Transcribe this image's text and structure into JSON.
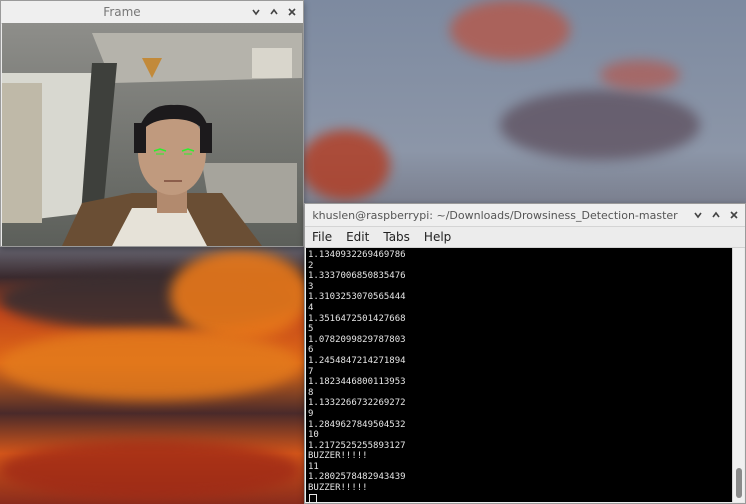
{
  "frame_window": {
    "title": "Frame",
    "controls": [
      "chevron-down-icon",
      "chevron-up-icon",
      "close-icon"
    ]
  },
  "terminal_window": {
    "title": "khuslen@raspberrypi: ~/Downloads/Drowsiness_Detection-master",
    "menu": [
      "File",
      "Edit",
      "Tabs",
      "Help"
    ],
    "lines": [
      "1.1340932269469786",
      "2",
      "1.3337006850835476",
      "3",
      "1.3103253070565444",
      "4",
      "1.3516472501427668",
      "5",
      "1.0782099829787803",
      "6",
      "1.2454847214271894",
      "7",
      "1.1823446800113953",
      "8",
      "1.1332266732269272",
      "9",
      "1.2849627849504532",
      "10",
      "1.2172525255893127",
      "BUZZER!!!!!",
      "11",
      "1.2802578482943439",
      "BUZZER!!!!!"
    ]
  }
}
